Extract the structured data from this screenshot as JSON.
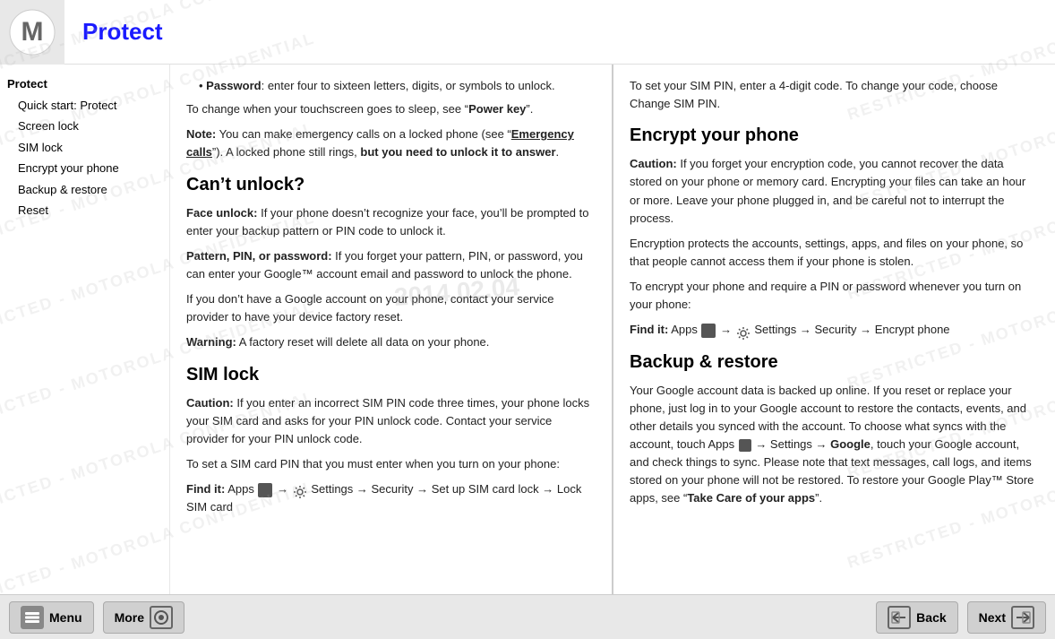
{
  "header": {
    "title": "Protect",
    "logo_alt": "Motorola logo"
  },
  "sidebar": {
    "items": [
      {
        "label": "Protect",
        "indented": false,
        "active": true
      },
      {
        "label": "Quick start: Protect",
        "indented": true,
        "active": false
      },
      {
        "label": "Screen lock",
        "indented": true,
        "active": false
      },
      {
        "label": "SIM lock",
        "indented": true,
        "active": false
      },
      {
        "label": "Encrypt your phone",
        "indented": true,
        "active": false
      },
      {
        "label": "Backup & restore",
        "indented": true,
        "active": false
      },
      {
        "label": "Reset",
        "indented": true,
        "active": false
      }
    ]
  },
  "left_content": {
    "bullet_password": "Password: enter four to sixteen letters, digits, or symbols to unlock.",
    "change_note": "To change when your touchscreen goes to sleep, see “Power key”.",
    "note_label": "Note:",
    "note_text": " You can make emergency calls on a locked phone (see “Emergency calls”). A locked phone still rings, but you need to unlock it to answer.",
    "cant_unlock_heading": "Can’t unlock?",
    "face_unlock_label": "Face unlock:",
    "face_unlock_text": " If your phone doesn’t recognize your face, you’ll be prompted to enter your backup pattern or PIN code to unlock it.",
    "pattern_label": "Pattern, PIN, or password:",
    "pattern_text": " If you forget your pattern, PIN, or password, you can enter your Google™ account email and password to unlock the phone.",
    "no_google_text": "If you don’t have a Google account on your phone, contact your service provider to have your device factory reset.",
    "warning_label": "Warning:",
    "warning_text": " A factory reset will delete all data on your phone.",
    "sim_lock_heading": "SIM lock",
    "sim_caution_label": "Caution:",
    "sim_caution_text": " If you enter an incorrect SIM PIN code three times, your phone locks your SIM card and asks for your PIN unlock code. Contact your service provider for your PIN unlock code.",
    "sim_set_text": "To set a SIM card PIN that you must enter when you turn on your phone:",
    "sim_find_label": "Find it:",
    "sim_find_text": " Apps ➜ Settings → Security → Set up SIM card lock → Lock SIM card"
  },
  "right_content": {
    "sim_pin_text": "To set your SIM PIN, enter a 4-digit code. To change your code, choose Change SIM PIN.",
    "encrypt_heading": "Encrypt your phone",
    "encrypt_caution_label": "Caution:",
    "encrypt_caution_text": " If you forget your encryption code, you cannot recover the data stored on your phone or memory card. Encrypting your files can take an hour or more. Leave your phone plugged in, and be careful not to interrupt the process.",
    "encrypt_protects_text": "Encryption protects the accounts, settings, apps, and files on your phone, so that people cannot access them if your phone is stolen.",
    "encrypt_require_text": "To encrypt your phone and require a PIN or password whenever you turn on your phone:",
    "encrypt_find_label": "Find it:",
    "encrypt_find_text": " Apps ➜ Settings → Security → Encrypt phone",
    "backup_heading": "Backup & restore",
    "backup_text": "Your Google account data is backed up online. If you reset or replace your phone, just log in to your Google account to restore the contacts, events, and other details you synced with the account. To choose what syncs with the account, touch Apps ➜ Settings → Google, touch your Google account, and check things to sync. Please note that text messages, call logs, and items stored on your phone will not be restored. To restore your Google Play™ Store apps, see “Take Care of your apps”."
  },
  "footer": {
    "menu_label": "Menu",
    "more_label": "More",
    "back_label": "Back",
    "next_label": "Next"
  },
  "watermark": {
    "lines": [
      "RESTRICTED - MOTOROLA CONFIDENTIAL",
      "RESTRICTED - MOTOROLA CONFIDENTIAL",
      "RESTRICTED - MOTOROLA CONFIDENTIAL",
      "RESTRICTED - MOTOROLA CONFIDENTIAL",
      "RESTRICTED - MOTOROLA CONFIDENTIAL",
      "RESTRICTED - MOTOROLA CONFIDENTIAL"
    ]
  }
}
